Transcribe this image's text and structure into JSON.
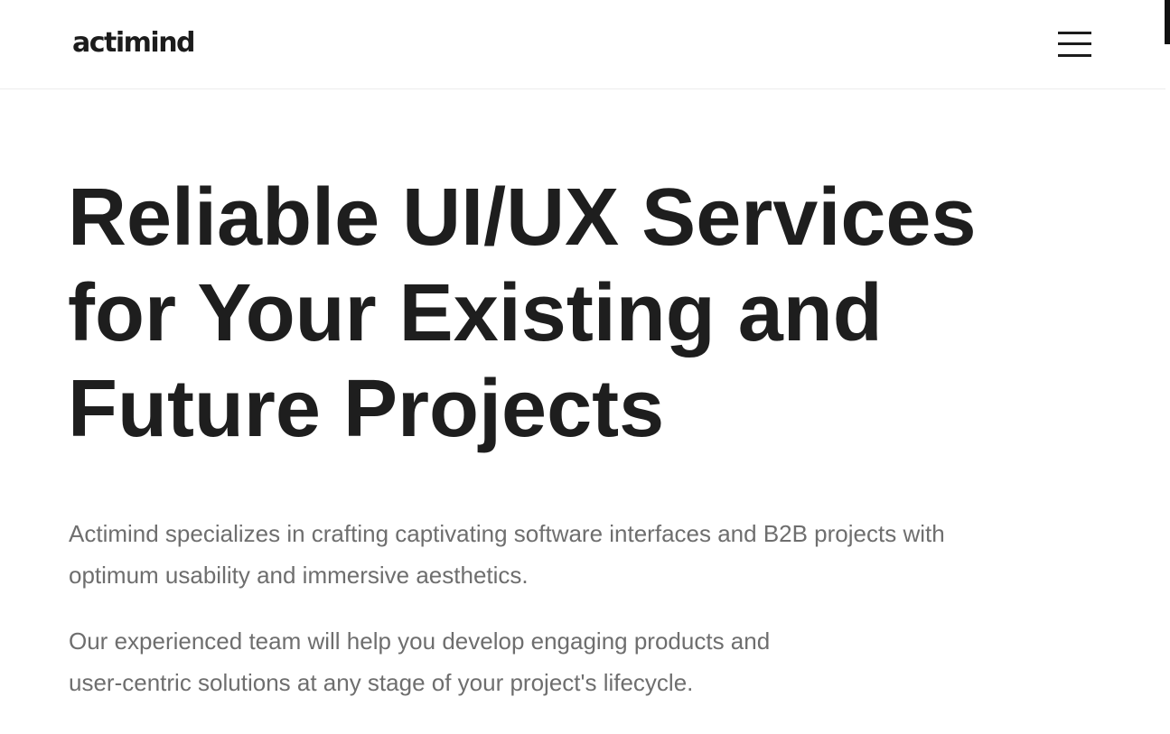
{
  "header": {
    "logo": "actimind",
    "menu_icon": "hamburger-menu-icon"
  },
  "hero": {
    "title_lines": [
      "Reliable UI/UX Services",
      "for Your Existing and",
      "Future Projects"
    ],
    "paragraph1_lines": [
      "Actimind specializes in crafting captivating software interfaces and B2B projects with",
      "optimum usability and immersive aesthetics."
    ],
    "paragraph2_lines": [
      "Our experienced team will help you develop engaging products and",
      "user-centric solutions at any stage of your project's lifecycle."
    ]
  },
  "colors": {
    "text_dark": "#1e1e1e",
    "text_muted": "#6e6e6e",
    "background": "#ffffff",
    "divider": "#ececec"
  }
}
